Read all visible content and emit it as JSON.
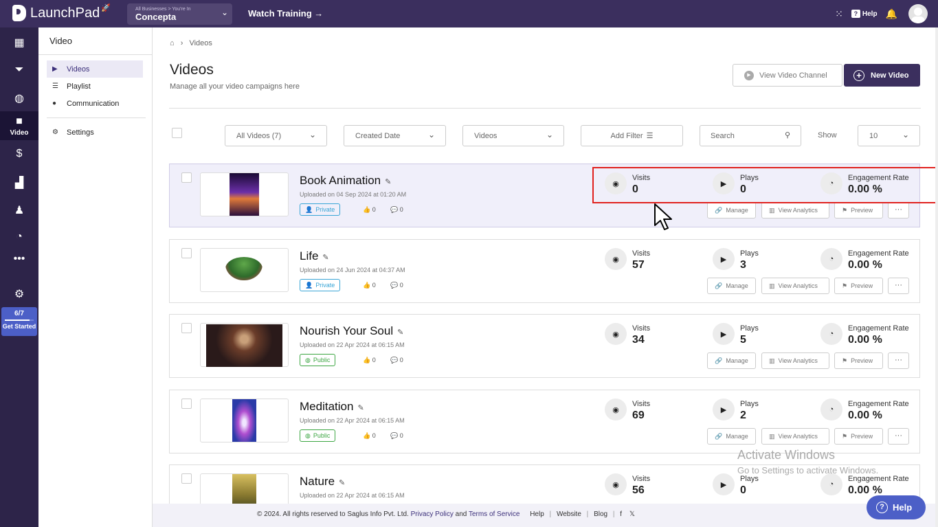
{
  "app": {
    "name": "LaunchPad",
    "business_caption": "All Businesses > You're In",
    "business_name": "Concepta",
    "watch_training": "Watch Training →",
    "help_label": "Help"
  },
  "rail": {
    "video_label": "Video",
    "get_started_progress": "6/7",
    "get_started_fraction": 0.857,
    "get_started_label": "Get Started"
  },
  "sidebar": {
    "title": "Video",
    "items": [
      {
        "label": "Videos",
        "icon": "video-icon",
        "active": true
      },
      {
        "label": "Playlist",
        "icon": "playlist-icon"
      },
      {
        "label": "Communication",
        "icon": "communication-icon"
      }
    ],
    "settings_label": "Settings"
  },
  "breadcrumb": {
    "current": "Videos"
  },
  "page": {
    "title": "Videos",
    "subtitle": "Manage all your video campaigns here",
    "view_channel_label": "View Video Channel",
    "new_video_label": "New Video"
  },
  "filters": {
    "all_videos": "All Videos (7)",
    "created_date": "Created Date",
    "type": "Videos",
    "add_filter": "Add Filter",
    "search_placeholder": "Search",
    "show_label": "Show",
    "show_value": "10"
  },
  "stat_labels": {
    "visits": "Visits",
    "plays": "Plays",
    "engagement": "Engagement Rate"
  },
  "action_labels": {
    "manage": "Manage",
    "analytics": "View Analytics",
    "preview": "Preview",
    "more": "···"
  },
  "videos": [
    {
      "title": "Book Animation",
      "uploaded": "Uploaded on 04 Sep 2024 at 01:20 AM",
      "visibility": "Private",
      "likes": "0",
      "comments": "0",
      "visits": "0",
      "plays": "0",
      "engagement": "0.00 %"
    },
    {
      "title": "Life",
      "uploaded": "Uploaded on 24 Jun 2024 at 04:37 AM",
      "visibility": "Private",
      "likes": "0",
      "comments": "0",
      "visits": "57",
      "plays": "3",
      "engagement": "0.00 %"
    },
    {
      "title": "Nourish Your Soul",
      "uploaded": "Uploaded on 22 Apr 2024 at 06:15 AM",
      "visibility": "Public",
      "likes": "0",
      "comments": "0",
      "visits": "34",
      "plays": "5",
      "engagement": "0.00 %"
    },
    {
      "title": "Meditation",
      "uploaded": "Uploaded on 22 Apr 2024 at 06:15 AM",
      "visibility": "Public",
      "likes": "0",
      "comments": "0",
      "visits": "69",
      "plays": "2",
      "engagement": "0.00 %"
    },
    {
      "title": "Nature",
      "uploaded": "Uploaded on 22 Apr 2024 at 06:15 AM",
      "visits": "56",
      "plays": "0",
      "engagement": "0.00 %"
    }
  ],
  "footer": {
    "copyright": "© 2024. All rights reserved to Saglus Info Pvt. Ltd.",
    "privacy": "Privacy Policy",
    "and": "and",
    "terms": "Terms of Service",
    "help": "Help",
    "website": "Website",
    "blog": "Blog"
  },
  "watermark": {
    "line1": "Activate Windows",
    "line2": "Go to Settings to activate Windows."
  },
  "help_button": "Help",
  "colors": {
    "brand": "#3b2f5e",
    "highlight": "#e0201d",
    "accent": "#4c5fc7"
  }
}
